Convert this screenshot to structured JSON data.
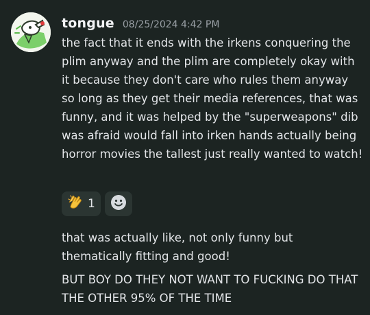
{
  "message": {
    "username": "tongue",
    "timestamp": "08/25/2024 4:42 PM",
    "paragraphs": [
      "the fact that it ends with the irkens conquering the plim anyway and the plim are completely okay with it because they don't care who rules them anyway so long as they get their media references, that was funny, and it was helped by the \"superweapons\" dib was afraid would fall into irken hands actually being horror movies the tallest just really wanted to watch!",
      "that was actually like, not only funny but thematically fitting and good!",
      "BUT BOY DO THEY NOT WANT TO FUCKING DO THAT THE OTHER 95% OF THE TIME"
    ]
  },
  "reactions": [
    {
      "emoji": "clapping-hands",
      "count": "1"
    }
  ],
  "colors": {
    "background": "#1c2422",
    "reaction_bg": "#2b3532",
    "username": "#f2f3f5",
    "timestamp": "#9aa0a6",
    "text": "#e3e5e8"
  }
}
